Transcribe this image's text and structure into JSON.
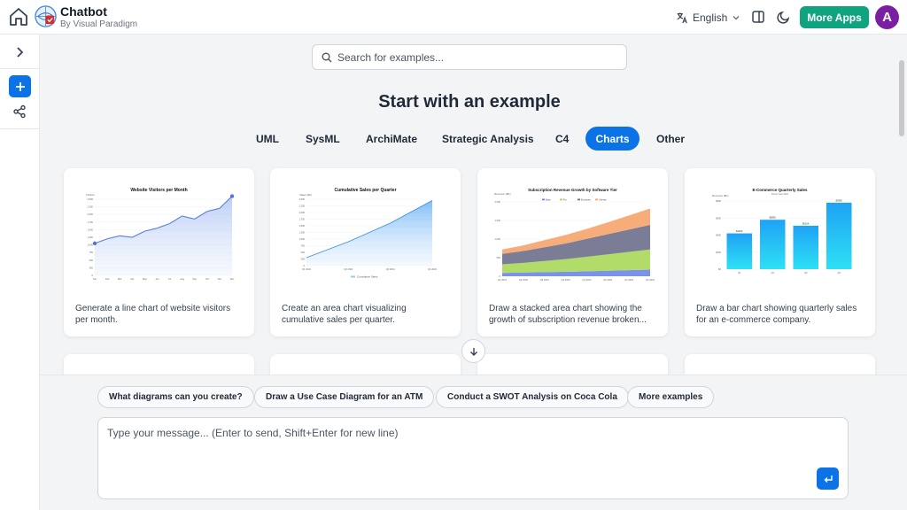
{
  "header": {
    "title": "Chatbot",
    "subtitle": "By Visual Paradigm",
    "language": "English",
    "more_apps_label": "More Apps",
    "avatar_initial": "A",
    "brand_color": "#10a37f",
    "avatar_color": "#7b1fa2"
  },
  "sidebar": {
    "accent": "#0b73e6"
  },
  "search": {
    "placeholder": "Search for examples..."
  },
  "main": {
    "heading": "Start with an example",
    "tabs": [
      {
        "label": "UML",
        "active": false
      },
      {
        "label": "SysML",
        "active": false
      },
      {
        "label": "ArchiMate",
        "active": false
      },
      {
        "label": "Strategic Analysis",
        "active": false
      },
      {
        "label": "C4",
        "active": false
      },
      {
        "label": "Charts",
        "active": true
      },
      {
        "label": "Other",
        "active": false
      }
    ],
    "cards": [
      {
        "description": "Generate a line chart of website visitors per month.",
        "thumb": {
          "title": "Website Visitors per Month",
          "ylabel": "Visitors",
          "y_ticks": [
            "2,500",
            "2,250",
            "2,000",
            "1,750",
            "1,500",
            "1,250",
            "1,000",
            "750",
            "500",
            "250",
            "0"
          ],
          "x_ticks": [
            "Jan",
            "Feb",
            "Mar",
            "Apr",
            "May",
            "Jun",
            "Jul",
            "Aug",
            "Sep",
            "Oct",
            "Nov",
            "Dec"
          ]
        }
      },
      {
        "description": "Create an area chart visualizing cumulative sales per quarter.",
        "thumb": {
          "title": "Cumulative Sales per Quarter",
          "ylabel": "Sales ($K)",
          "y_ticks": [
            "2,500",
            "2,250",
            "2,000",
            "1,750",
            "1,500",
            "1,250",
            "1,000",
            "750",
            "500",
            "250",
            "0"
          ],
          "x_ticks": [
            "Q1 2024",
            "Q2 2024",
            "Q3 2024",
            "Q4 2024"
          ],
          "legend": "Cumulative Sales"
        }
      },
      {
        "description": "Draw a stacked area chart showing the growth of subscription revenue broken...",
        "thumb": {
          "title": "Subscription Revenue Growth by Software Tier",
          "ylabel": "Revenue ($K)",
          "legend": [
            "Basic",
            "Pro",
            "Enterprise",
            "Ultimate"
          ],
          "y_ticks": [
            "2,000",
            "1,500",
            "1,000",
            "500",
            "0"
          ],
          "x_ticks": [
            "Q1 2023",
            "Q2 2023",
            "Q3 2023",
            "Q4 2023",
            "Q1 2024",
            "Q2 2024",
            "Q3 2024",
            "Q4 2024"
          ]
        }
      },
      {
        "description": "Draw a bar chart showing quarterly sales for an e-commerce company.",
        "thumb": {
          "title": "E-Commerce Quarterly Sales",
          "ylabel": "Revenue ($K)",
          "subtitle": "Fiscal Year 2024",
          "y_ticks": [
            "$800",
            "$600",
            "$400",
            "$200",
            "$0"
          ],
          "x_ticks": [
            "Q1",
            "Q2",
            "Q3",
            "Q4"
          ],
          "bar_labels": [
            "$420K",
            "$580K",
            "$510K",
            "$780K"
          ]
        }
      }
    ]
  },
  "chart_data": [
    {
      "type": "line",
      "title": "Website Visitors per Month",
      "ylabel": "Visitors",
      "categories": [
        "Jan",
        "Feb",
        "Mar",
        "Apr",
        "May",
        "Jun",
        "Jul",
        "Aug",
        "Sep",
        "Oct",
        "Nov",
        "Dec"
      ],
      "values": [
        1050,
        1200,
        1300,
        1250,
        1450,
        1550,
        1700,
        1950,
        1850,
        2100,
        2200,
        2600
      ],
      "ylim": [
        0,
        2500
      ]
    },
    {
      "type": "area",
      "title": "Cumulative Sales per Quarter",
      "ylabel": "Sales ($K)",
      "categories": [
        "Q1 2024",
        "Q2 2024",
        "Q3 2024",
        "Q4 2024"
      ],
      "values": [
        300,
        900,
        1600,
        2450
      ],
      "ylim": [
        0,
        2500
      ],
      "series": [
        {
          "name": "Cumulative Sales",
          "values": [
            300,
            900,
            1600,
            2450
          ]
        }
      ]
    },
    {
      "type": "area",
      "title": "Subscription Revenue Growth by Software Tier",
      "ylabel": "Revenue ($K)",
      "categories": [
        "Q1 2023",
        "Q2 2023",
        "Q3 2023",
        "Q4 2023",
        "Q1 2024",
        "Q2 2024",
        "Q3 2024",
        "Q4 2024"
      ],
      "series": [
        {
          "name": "Basic",
          "values": [
            90,
            100,
            110,
            120,
            135,
            150,
            165,
            180
          ]
        },
        {
          "name": "Pro",
          "values": [
            230,
            260,
            300,
            340,
            390,
            440,
            490,
            540
          ]
        },
        {
          "name": "Enterprise",
          "values": [
            280,
            320,
            370,
            420,
            480,
            540,
            600,
            660
          ]
        },
        {
          "name": "Ultimate",
          "values": [
            120,
            150,
            190,
            230,
            270,
            320,
            380,
            440
          ]
        }
      ],
      "ylim": [
        0,
        2000
      ]
    },
    {
      "type": "bar",
      "title": "E-Commerce Quarterly Sales",
      "ylabel": "Revenue ($K)",
      "categories": [
        "Q1",
        "Q2",
        "Q3",
        "Q4"
      ],
      "values": [
        420,
        580,
        510,
        780
      ],
      "ylim": [
        0,
        800
      ]
    }
  ],
  "bottom": {
    "suggestions": [
      "What diagrams can you create?",
      "Draw a Use Case Diagram for an ATM",
      "Conduct a SWOT Analysis on Coca Cola",
      "More examples"
    ],
    "message_placeholder": "Type your message... (Enter to send, Shift+Enter for new line)"
  }
}
